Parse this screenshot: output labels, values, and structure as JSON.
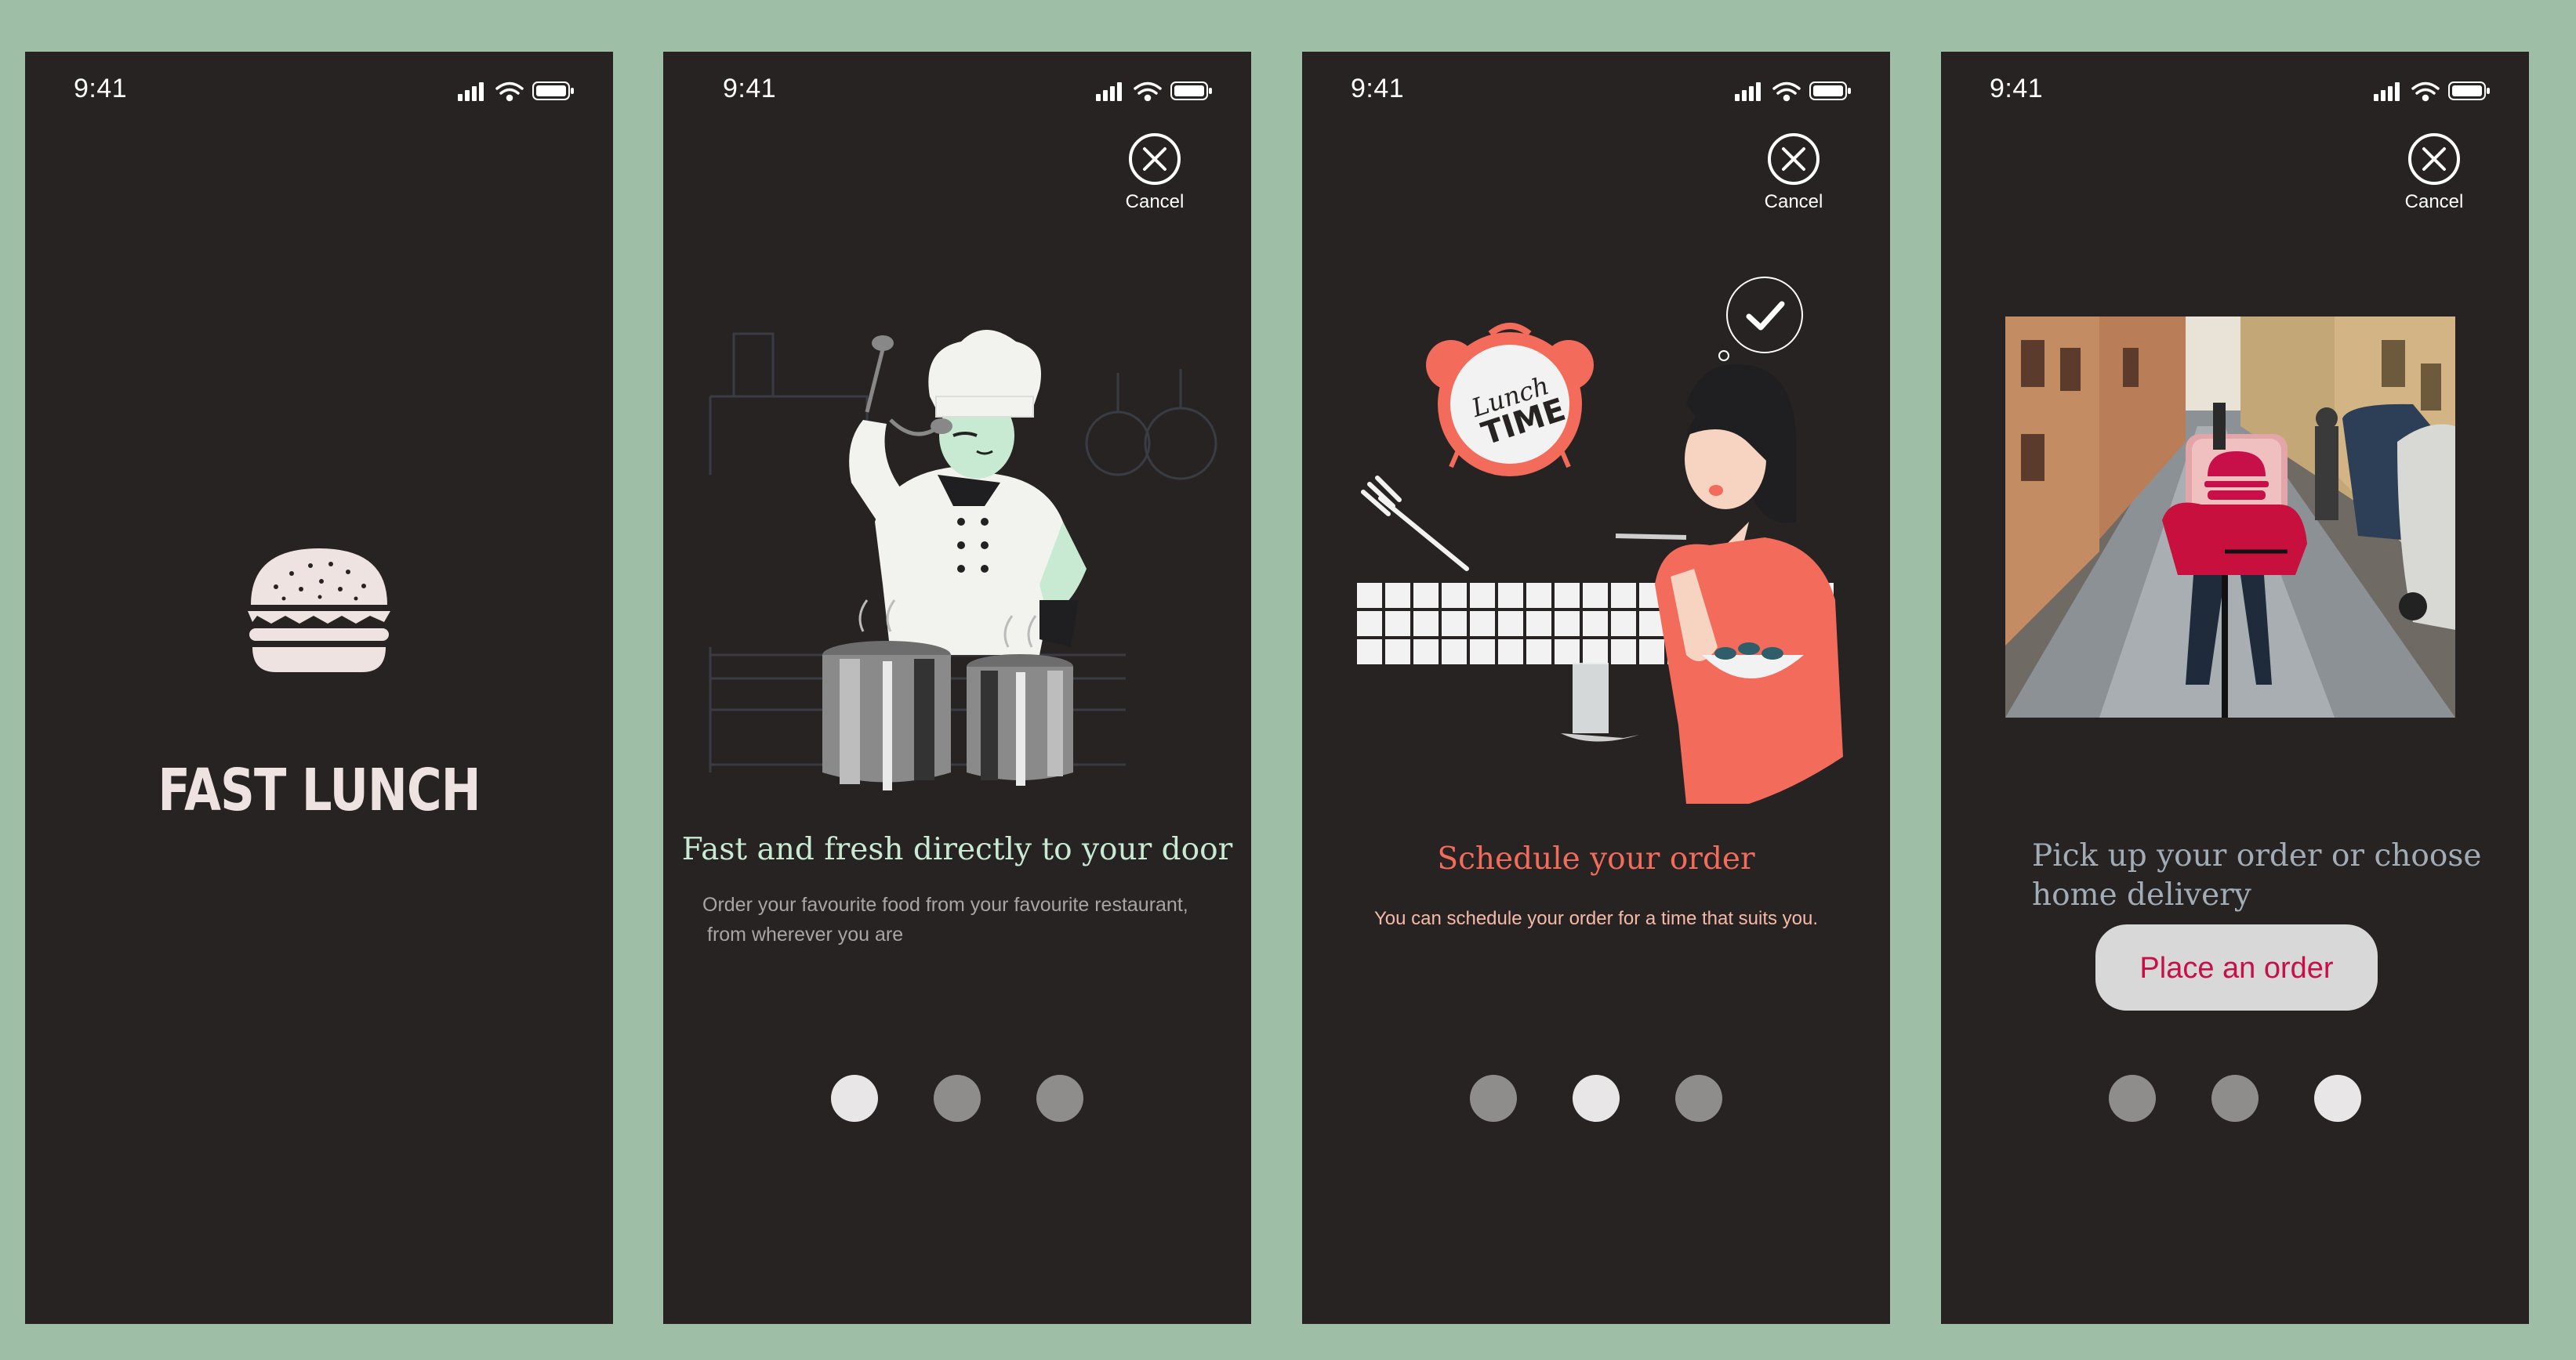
{
  "status": {
    "time": "9:41"
  },
  "splash": {
    "title": "FAST LUNCH"
  },
  "slides": [
    {
      "cancel": "Cancel",
      "title": "Fast and fresh directly to your door",
      "text_lines": [
        "Order your favourite food from your favourite restaurant,",
        "from wherever you are"
      ],
      "active_dot": 0
    },
    {
      "cancel": "Cancel",
      "title": "Schedule your order",
      "clock_text_1": "Lunch",
      "clock_text_2": "TIME",
      "text_lines": [
        "You can schedule your order for a time that suits you."
      ],
      "active_dot": 1
    },
    {
      "cancel": "Cancel",
      "title_lines": [
        "Pick up your order or choose",
        "home delivery"
      ],
      "button": "Place an order",
      "active_dot": 2
    }
  ],
  "colors": {
    "background": "#9fbea6",
    "screen": "#272322",
    "mint": "#c8ead2",
    "coral": "#f26b5b",
    "grey_blue": "#a1adb6",
    "crimson": "#c70f4a"
  },
  "icons": [
    "signal-icon",
    "wifi-icon",
    "battery-icon",
    "close-icon",
    "burger-icon",
    "check-icon"
  ]
}
